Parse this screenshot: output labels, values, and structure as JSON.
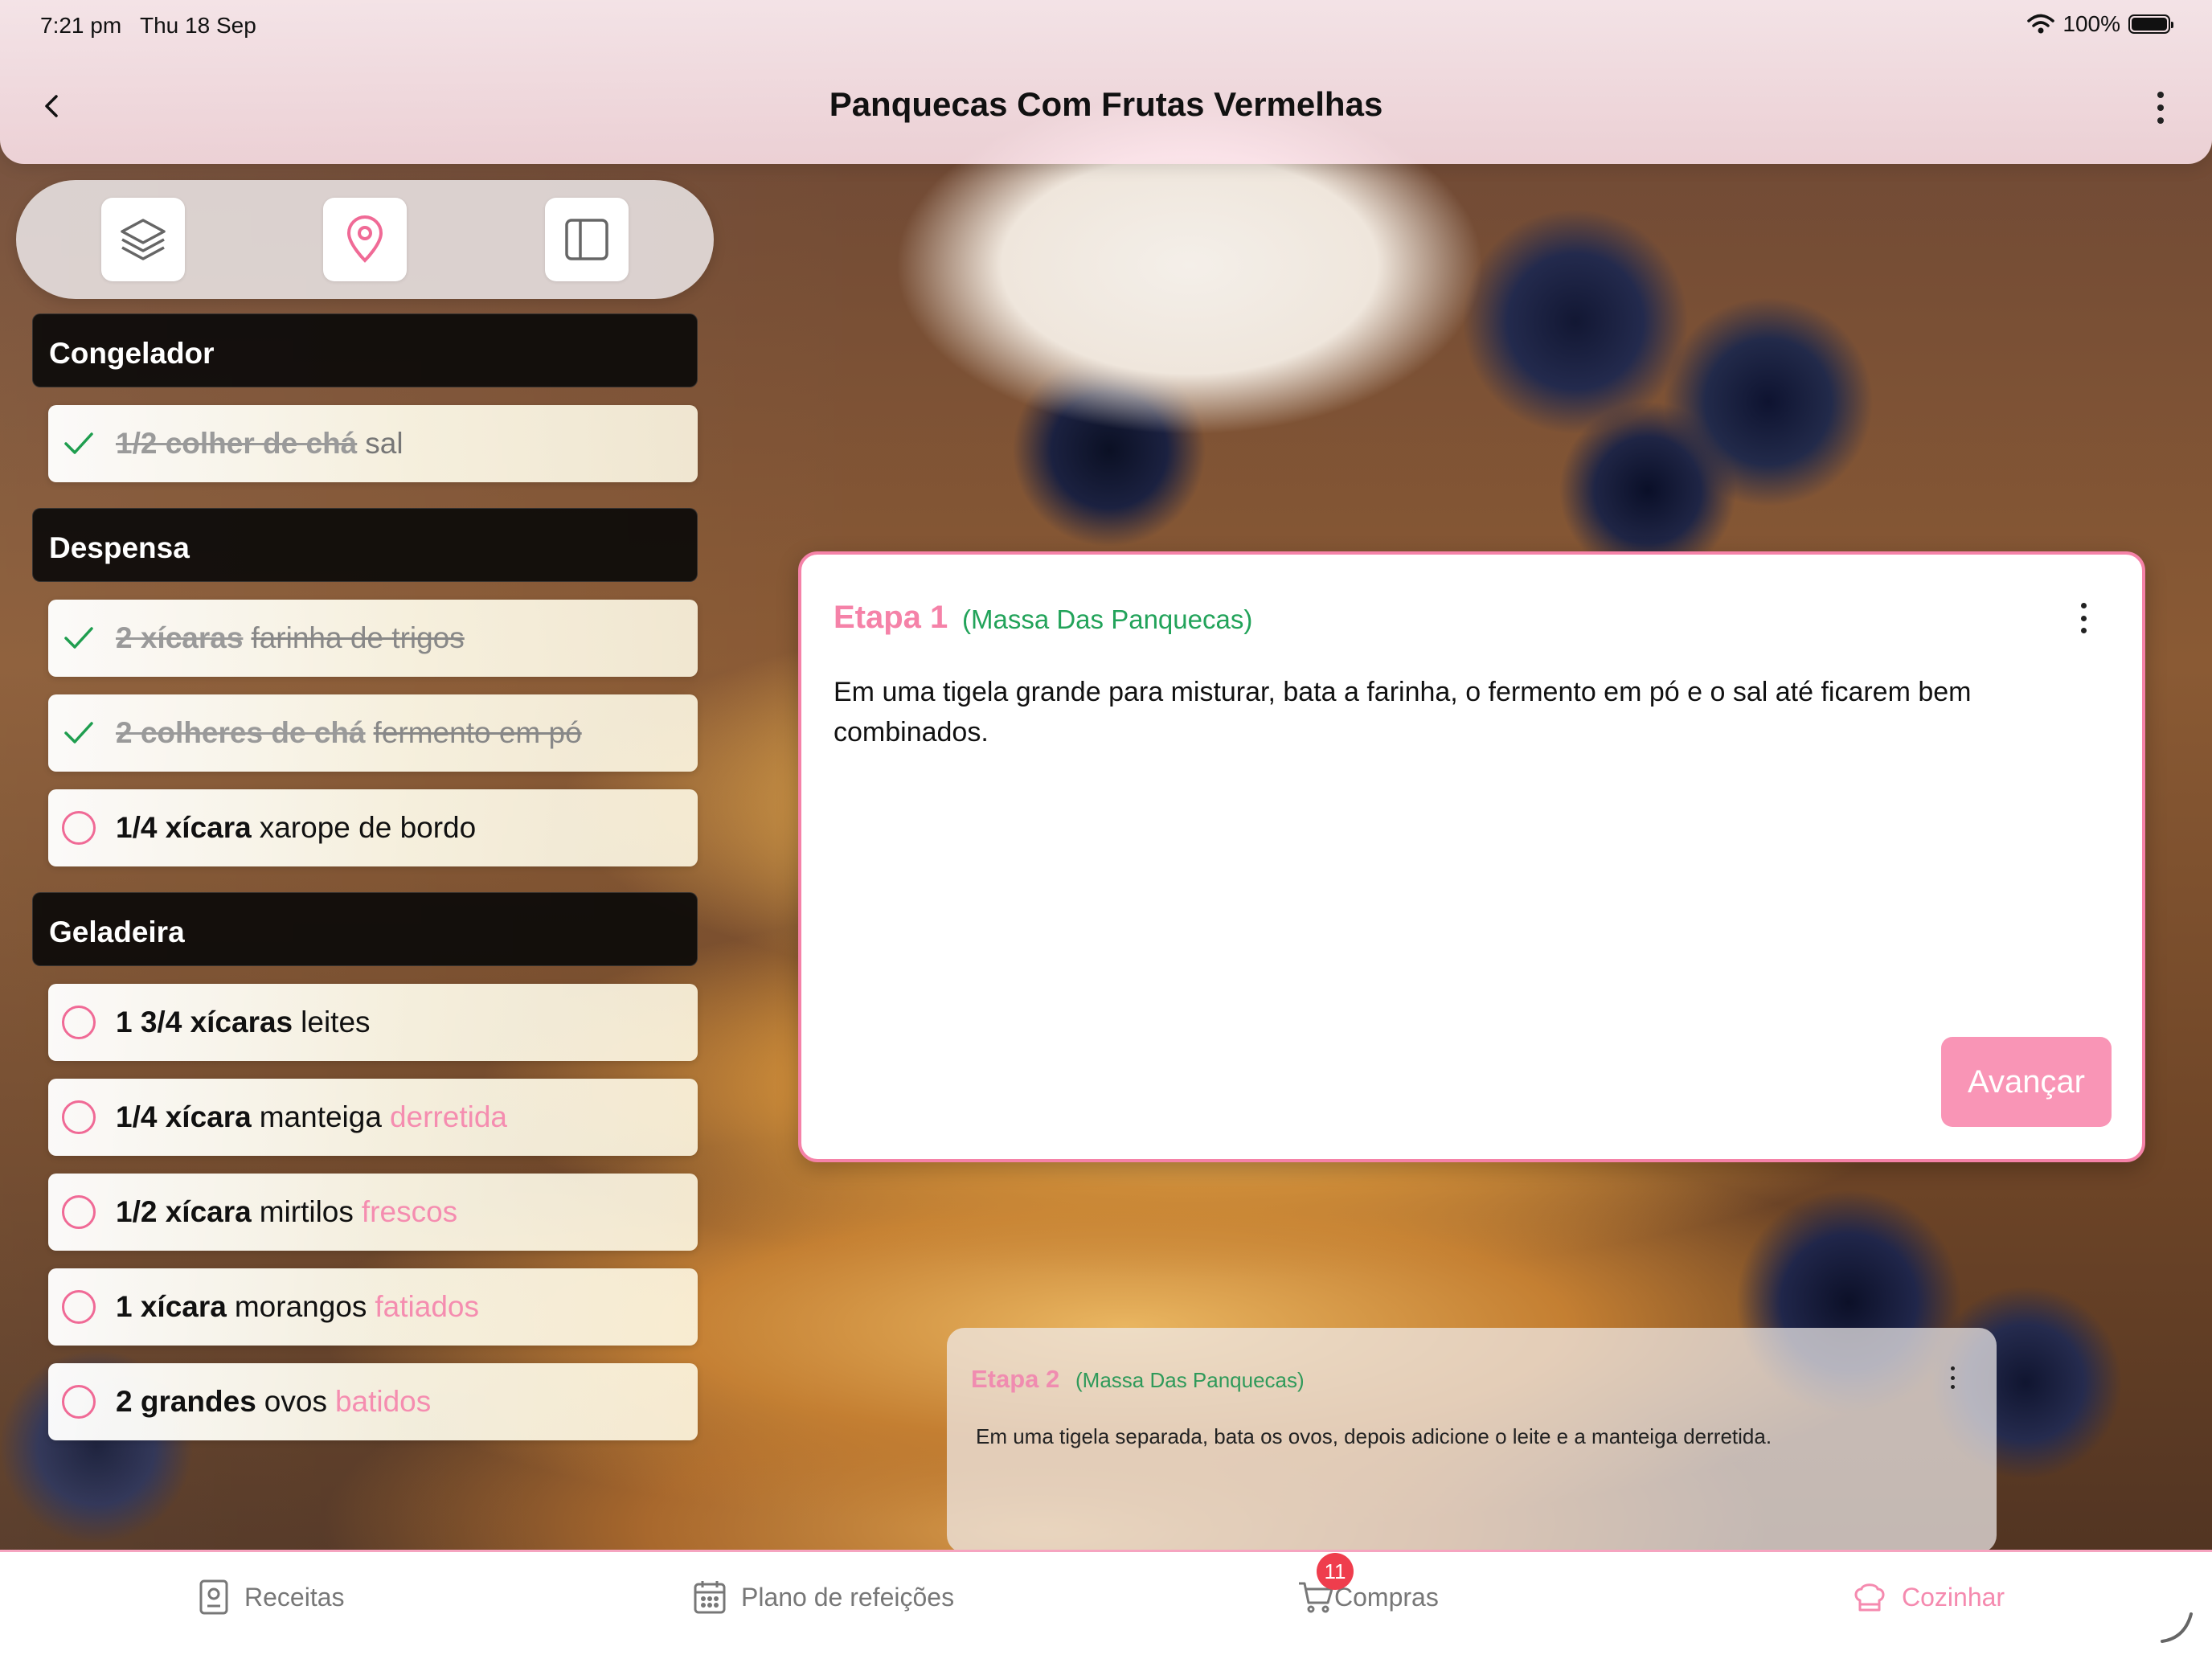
{
  "status_bar": {
    "time": "7:21 pm   Thu 18 Sep",
    "battery": "100%"
  },
  "header": {
    "title": "Panquecas Com Frutas Vermelhas",
    "back_icon": "chevron-left-icon",
    "more_icon": "more-vertical-icon"
  },
  "toolbar": {
    "buttons": [
      {
        "icon": "layers-icon"
      },
      {
        "icon": "map-pin-icon"
      },
      {
        "icon": "sidebar-panel-icon"
      }
    ]
  },
  "ingredients": {
    "sections": [
      {
        "name": "Congelador",
        "items": [
          {
            "qty": "1/2 colher de chá",
            "name": "sal",
            "note": "",
            "checked": true
          }
        ]
      },
      {
        "name": "Despensa",
        "items": [
          {
            "qty": "2 xícaras",
            "name": "farinha de trigos",
            "note": "",
            "checked": true
          },
          {
            "qty": "2 colheres de chá",
            "name": "fermento em pó",
            "note": "",
            "checked": true
          },
          {
            "qty": "1/4 xícara",
            "name": "xarope de bordo",
            "note": "",
            "checked": false
          }
        ]
      },
      {
        "name": "Geladeira",
        "items": [
          {
            "qty": "1 3/4 xícaras",
            "name": "leites",
            "note": "",
            "checked": false
          },
          {
            "qty": "1/4 xícara",
            "name": "manteiga",
            "note": "derretida",
            "checked": false
          },
          {
            "qty": "1/2 xícara",
            "name": "mirtilos",
            "note": "frescos",
            "checked": false
          },
          {
            "qty": "1 xícara",
            "name": "morangos",
            "note": "fatiados",
            "checked": false
          },
          {
            "qty": "2 grandes",
            "name": "ovos",
            "note": "batidos",
            "checked": false
          }
        ]
      }
    ]
  },
  "current_step": {
    "label": "Etapa 1",
    "section": "(Massa Das Panquecas)",
    "description": "Em uma tigela grande para misturar, bata a farinha, o fermento em pó e o sal até ficarem bem combinados.",
    "advance_label": "Avançar"
  },
  "next_step": {
    "label": "Etapa 2",
    "section": "(Massa Das Panquecas)",
    "description": "Em uma tigela separada, bata os ovos, depois adicione o leite e a manteiga derretida."
  },
  "tabbar": {
    "tabs": [
      {
        "label": "Receitas",
        "icon": "recipe-book-icon",
        "active": false
      },
      {
        "label": "Plano de refeições",
        "icon": "calendar-icon",
        "active": false
      },
      {
        "label": "Compras",
        "icon": "cart-icon",
        "active": false,
        "badge": "11"
      },
      {
        "label": "Cozinhar",
        "icon": "chef-hat-icon",
        "active": true
      }
    ]
  },
  "colors": {
    "accent_pink": "#f582a8",
    "section_green": "#22a35a",
    "badge_red": "#ef3d4d"
  }
}
